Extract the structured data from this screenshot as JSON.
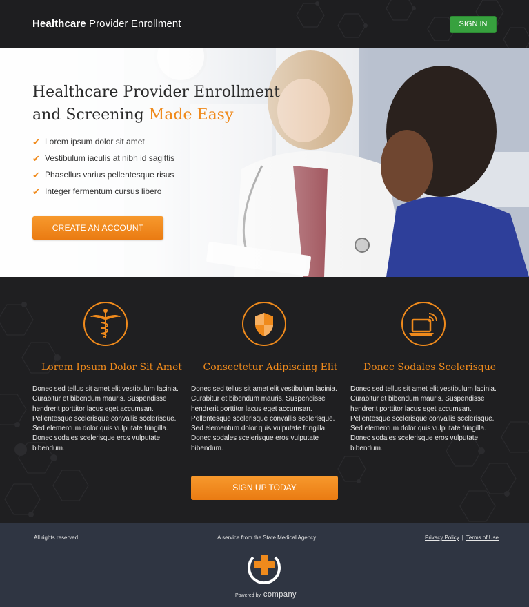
{
  "header": {
    "brand_bold": "Healthcare",
    "brand_rest": " Provider Enrollment",
    "signin_label": "SIGN IN"
  },
  "hero": {
    "title_line1": "Healthcare Provider Enrollment",
    "title_line2_plain": "and Screening ",
    "title_line2_accent": "Made Easy",
    "bullets": [
      "Lorem ipsum dolor sit amet",
      "Vestibulum iaculis at nibh id sagittis",
      "Phasellus varius pellentesque risus",
      "Integer fermentum cursus libero"
    ],
    "cta_label": "CREATE AN ACCOUNT"
  },
  "features": {
    "items": [
      {
        "icon": "caduceus-icon",
        "title": "Lorem Ipsum Dolor Sit Amet",
        "body": "Donec sed tellus sit amet elit vestibulum lacinia. Curabitur et bibendum mauris. Suspendisse hendrerit porttitor lacus eget accumsan. Pellentesque scelerisque convallis scelerisque. Sed elementum dolor quis vulputate fringilla. Donec sodales scelerisque eros vulputate bibendum."
      },
      {
        "icon": "shield-icon",
        "title": "Consectetur Adipiscing Elit",
        "body": "Donec sed tellus sit amet elit vestibulum lacinia. Curabitur et bibendum mauris. Suspendisse hendrerit porttitor lacus eget accumsan. Pellentesque scelerisque convallis scelerisque. Sed elementum dolor quis vulputate fringilla. Donec sodales scelerisque eros vulputate bibendum."
      },
      {
        "icon": "laptop-wifi-icon",
        "title": "Donec Sodales Scelerisque",
        "body": "Donec sed tellus sit amet elit vestibulum lacinia. Curabitur et bibendum mauris. Suspendisse hendrerit porttitor lacus eget accumsan. Pellentesque scelerisque convallis scelerisque. Sed elementum dolor quis vulputate fringilla. Donec sodales scelerisque eros vulputate bibendum."
      }
    ],
    "signup_label": "SIGN UP TODAY"
  },
  "footer": {
    "rights": "All rights reserved.",
    "service": "A service from the State Medical Agency",
    "privacy": "Privacy Policy",
    "separator": "|",
    "terms": "Terms of Use",
    "powered_by": "Powered by",
    "company": "company"
  },
  "colors": {
    "accent": "#ef8a1c",
    "signin_green": "#37a13e",
    "dark": "#1f1f21",
    "footer": "#2f3542"
  }
}
